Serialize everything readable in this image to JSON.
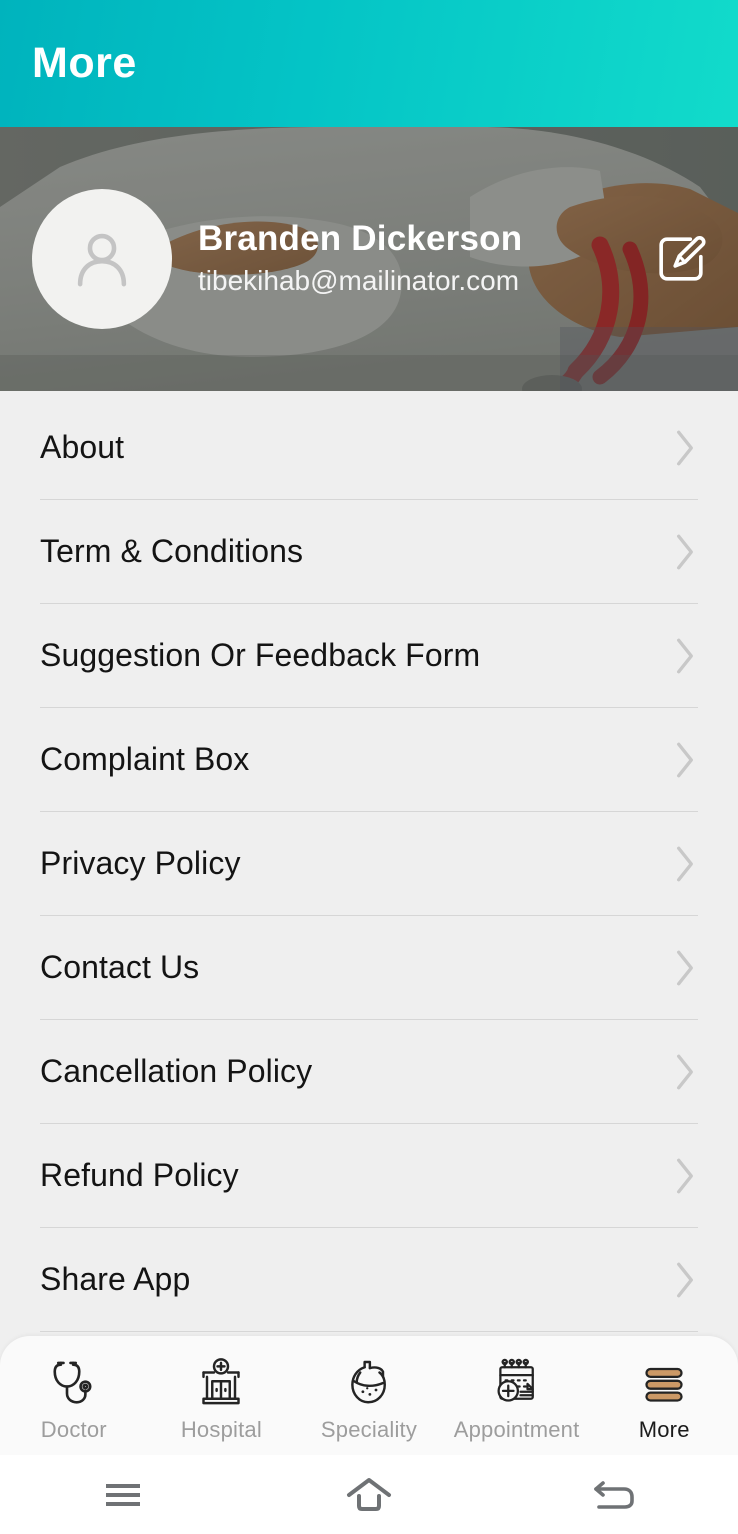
{
  "appbar": {
    "title": "More",
    "gradient_from": "#00b3bd",
    "gradient_to": "#12dbcb"
  },
  "profile": {
    "name": "Branden Dickerson",
    "email": "tibekihab@mailinator.com",
    "avatar_icon": "person-placeholder-icon",
    "edit_icon": "edit-pencil-square-icon",
    "banner_description": "doctor-with-stethoscope-photo"
  },
  "menu": {
    "items": [
      {
        "label": "About",
        "chevron": "chevron-right-icon"
      },
      {
        "label": "Term & Conditions",
        "chevron": "chevron-right-icon"
      },
      {
        "label": "Suggestion Or Feedback Form",
        "chevron": "chevron-right-icon"
      },
      {
        "label": "Complaint Box",
        "chevron": "chevron-right-icon"
      },
      {
        "label": "Privacy Policy",
        "chevron": "chevron-right-icon"
      },
      {
        "label": "Contact Us",
        "chevron": "chevron-right-icon"
      },
      {
        "label": "Cancellation Policy",
        "chevron": "chevron-right-icon"
      },
      {
        "label": "Refund Policy",
        "chevron": "chevron-right-icon"
      },
      {
        "label": "Share App",
        "chevron": "chevron-right-icon"
      }
    ]
  },
  "bottom_nav": {
    "active": "More",
    "active_color": "#1b1b1b",
    "inactive_color": "#9d9d9d",
    "active_icon_fill": "#cc9966",
    "items": [
      {
        "label": "Doctor",
        "icon": "stethoscope-icon",
        "active": false
      },
      {
        "label": "Hospital",
        "icon": "hospital-building-icon",
        "active": false
      },
      {
        "label": "Speciality",
        "icon": "anatomical-heart-icon",
        "active": false
      },
      {
        "label": "Appointment",
        "icon": "calendar-medical-icon",
        "active": false
      },
      {
        "label": "More",
        "icon": "hamburger-menu-icon",
        "active": true
      }
    ]
  },
  "system_nav": {
    "buttons": [
      {
        "name": "recents",
        "icon": "recents-lines-icon"
      },
      {
        "name": "home",
        "icon": "home-outline-icon"
      },
      {
        "name": "back",
        "icon": "back-arrow-icon"
      }
    ]
  }
}
